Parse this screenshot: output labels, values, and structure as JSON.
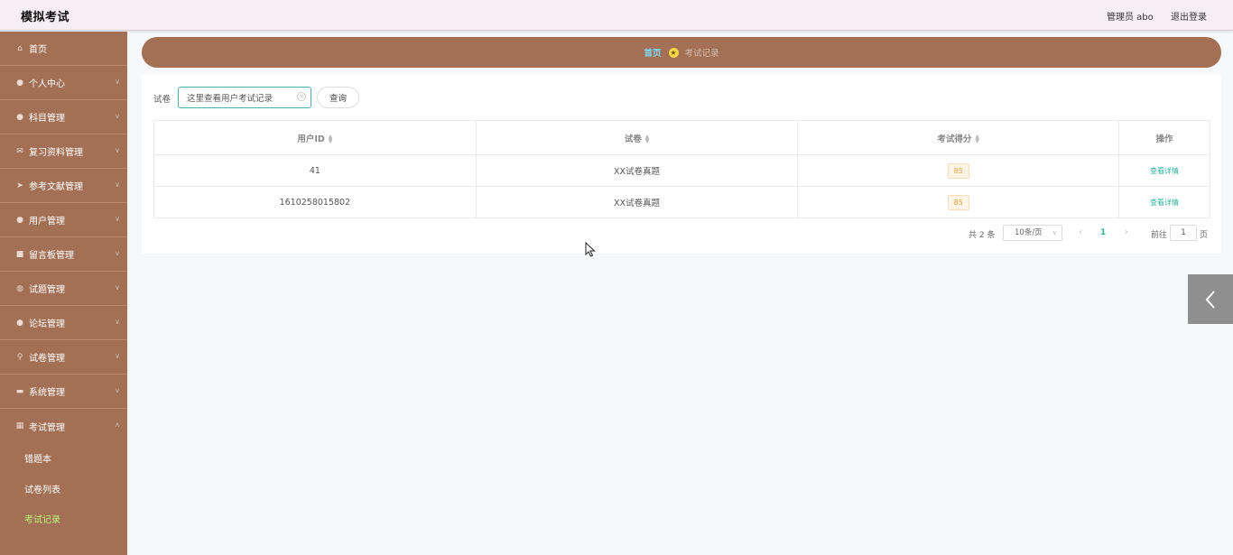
{
  "header": {
    "app_title": "模拟考试",
    "user": "管理员 abo",
    "logout": "退出登录"
  },
  "sidebar": {
    "items": [
      {
        "label": "首页",
        "icon": "home-icon"
      },
      {
        "label": "个人中心",
        "icon": "user-icon"
      },
      {
        "label": "科目管理",
        "icon": "person-icon"
      },
      {
        "label": "复习资料管理",
        "icon": "mail-icon"
      },
      {
        "label": "参考文献管理",
        "icon": "send-icon"
      },
      {
        "label": "用户管理",
        "icon": "user-icon"
      },
      {
        "label": "留言板管理",
        "icon": "suitcase-icon"
      },
      {
        "label": "试题管理",
        "icon": "globe-icon"
      },
      {
        "label": "论坛管理",
        "icon": "location-icon"
      },
      {
        "label": "试卷管理",
        "icon": "pin-icon"
      },
      {
        "label": "系统管理",
        "icon": "briefcase-icon"
      },
      {
        "label": "考试管理",
        "icon": "grid-icon"
      }
    ],
    "subitems": [
      {
        "label": "错题本"
      },
      {
        "label": "试卷列表"
      },
      {
        "label": "考试记录"
      }
    ],
    "active_color": "#b9f07a"
  },
  "breadcrumb": {
    "home": "首页",
    "current": "考试记录"
  },
  "search": {
    "label": "试卷",
    "value": "这里查看用户考试记录",
    "button": "查询"
  },
  "table": {
    "columns": [
      "用户ID",
      "试卷",
      "考试得分",
      "操作"
    ],
    "rows": [
      {
        "user_id": "41",
        "paper": "XX试卷真题",
        "score": "85",
        "action": "查看详情"
      },
      {
        "user_id": "1610258015802",
        "paper": "XX试卷真题",
        "score": "85",
        "action": "查看详情"
      }
    ]
  },
  "pagination": {
    "total": "共 2 条",
    "page_size": "10条/页",
    "current_page": "1",
    "goto_label": "前往",
    "goto_value": "1",
    "goto_unit": "页"
  },
  "colors": {
    "brand": "#a37055",
    "accent": "#2bb39a"
  }
}
